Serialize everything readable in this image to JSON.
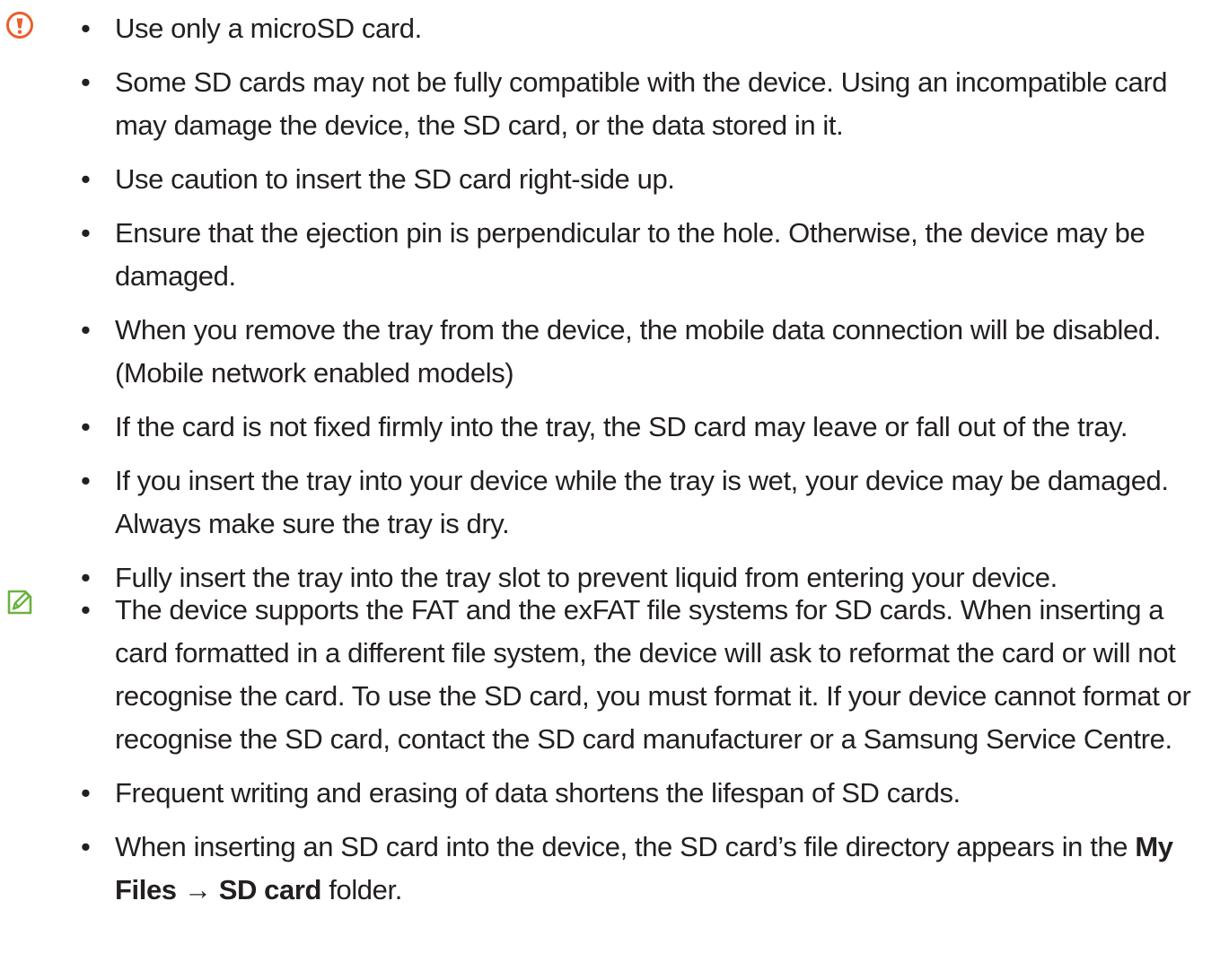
{
  "colors": {
    "caution_icon": "#e8602c",
    "note_icon": "#6ab33e",
    "text": "#231f20"
  },
  "caution": {
    "icon": "caution-exclamation-icon",
    "items": [
      "Use only a microSD card.",
      "Some SD cards may not be fully compatible with the device. Using an incompatible card may damage the device, the SD card, or the data stored in it.",
      "Use caution to insert the SD card right-side up.",
      "Ensure that the ejection pin is perpendicular to the hole. Otherwise, the device may be damaged.",
      "When you remove the tray from the device, the mobile data connection will be disabled. (Mobile network enabled models)",
      "If the card is not fixed firmly into the tray, the SD card may leave or fall out of the tray.",
      "If you insert the tray into your device while the tray is wet, your device may be damaged. Always make sure the tray is dry.",
      "Fully insert the tray into the tray slot to prevent liquid from entering your device."
    ]
  },
  "note": {
    "icon": "note-pencil-icon",
    "items": [
      "The device supports the FAT and the exFAT file systems for SD cards. When inserting a card formatted in a different file system, the device will ask to reformat the card or will not recognise the card. To use the SD card, you must format it. If your device cannot format or recognise the SD card, contact the SD card manufacturer or a Samsung Service Centre.",
      "Frequent writing and erasing of data shortens the lifespan of SD cards."
    ],
    "last_item": {
      "prefix": "When inserting an SD card into the device, the SD card’s file directory appears in the ",
      "path_1": "My Files",
      "arrow": " → ",
      "path_2": "SD card",
      "suffix": " folder."
    }
  },
  "bullet_char": "•"
}
